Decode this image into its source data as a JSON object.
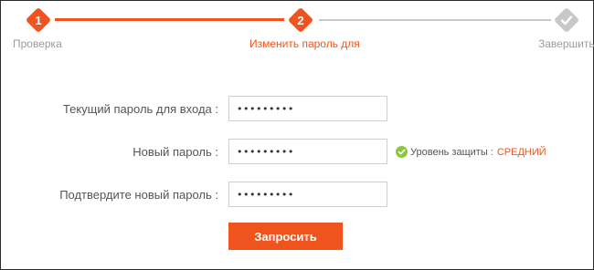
{
  "stepper": {
    "steps": [
      {
        "number": "1",
        "label": "Проверка",
        "state": "done"
      },
      {
        "number": "2",
        "label": "Изменить пароль для",
        "state": "active"
      },
      {
        "number": "",
        "label": "Завершить",
        "state": "pending",
        "icon": "check-icon"
      }
    ]
  },
  "form": {
    "current_password": {
      "label": "Текущий пароль для входа :",
      "value": "•••••••••"
    },
    "new_password": {
      "label": "Новый пароль :",
      "value": "•••••••••"
    },
    "confirm_password": {
      "label": "Подтвердите новый пароль :",
      "value": "•••••••••"
    },
    "strength": {
      "label": "Уровень защиты :",
      "level": "СРЕДНИЙ",
      "icon": "check-circle-icon"
    },
    "submit_label": "Запросить"
  },
  "colors": {
    "accent": "#f0541e",
    "inactive": "#c8c8c8",
    "ok": "#8cc63f",
    "text": "#555555"
  }
}
